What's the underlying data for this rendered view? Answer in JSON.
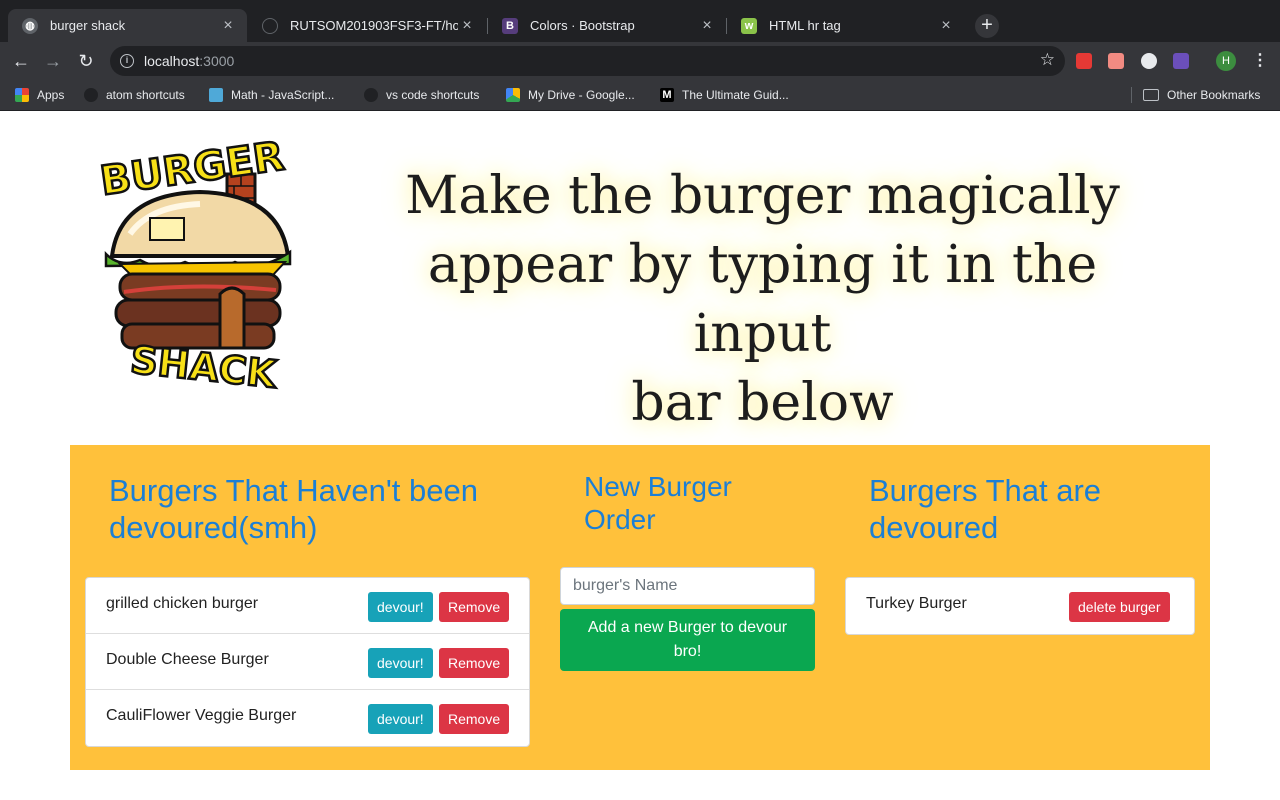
{
  "browser": {
    "tabs": [
      {
        "title": "burger shack",
        "active": true
      },
      {
        "title": "RUTSOM201903FSF3-FT/hom",
        "active": false
      },
      {
        "title": "Colors · Bootstrap",
        "active": false
      },
      {
        "title": "HTML hr tag",
        "active": false
      }
    ],
    "url_host": "localhost",
    "url_port": ":3000",
    "bookmarks": [
      {
        "label": "Apps"
      },
      {
        "label": "atom shortcuts"
      },
      {
        "label": "Math - JavaScript..."
      },
      {
        "label": "vs code shortcuts"
      },
      {
        "label": "My Drive - Google..."
      },
      {
        "label": "The Ultimate Guid..."
      }
    ],
    "other_bookmarks": "Other Bookmarks",
    "profile_initial": "H"
  },
  "logo": {
    "top_text": "BURGER",
    "bottom_text": "SHACK"
  },
  "hero": {
    "line1": "Make the burger magically",
    "line2": "appear by typing it in the input",
    "line3": "bar below"
  },
  "not_devoured": {
    "title_line1": "Burgers That Haven't been",
    "title_line2": "devoured(smh)",
    "devour_label": "devour!",
    "remove_label": "Remove",
    "items": [
      {
        "name": "grilled chicken burger"
      },
      {
        "name": "Double Cheese Burger"
      },
      {
        "name": "CauliFlower Veggie Burger"
      }
    ]
  },
  "new_order": {
    "title_line1": "New Burger",
    "title_line2": "Order",
    "placeholder": "burger's Name",
    "submit_line1": "Add a new Burger to devour",
    "submit_line2": "bro!"
  },
  "devoured": {
    "title_line1": "Burgers That are",
    "title_line2": "devoured",
    "delete_label": "delete burger",
    "items": [
      {
        "name": "Turkey Burger"
      }
    ]
  },
  "colors": {
    "panel": "#ffc13b",
    "title": "#1b7fd6",
    "devour": "#17a2b8",
    "remove": "#dc3545",
    "add": "#0aa750"
  }
}
